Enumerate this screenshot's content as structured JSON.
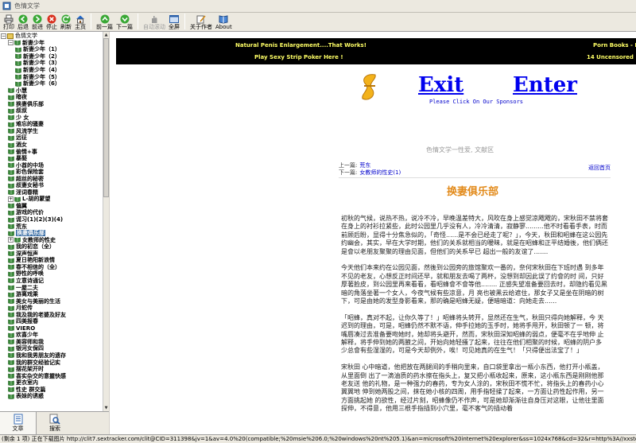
{
  "window": {
    "title": "色情文学"
  },
  "toolbar": {
    "buttons": [
      {
        "label": "打印",
        "icon": "print-icon"
      },
      {
        "label": "后退",
        "icon": "back-arrow-icon"
      },
      {
        "label": "前进",
        "icon": "forward-arrow-icon"
      },
      {
        "label": "停止",
        "icon": "stop-icon"
      },
      {
        "label": "刷新",
        "icon": "refresh-icon"
      },
      {
        "label": "主页",
        "icon": "home-icon"
      },
      {
        "label": "前一篇",
        "icon": "up-arrow-icon"
      },
      {
        "label": "下一篇",
        "icon": "down-arrow-icon"
      },
      {
        "label": "自动滚动",
        "icon": "hand-icon"
      },
      {
        "label": "全屏",
        "icon": "fullscreen-icon"
      },
      {
        "label": "关于作者",
        "icon": "author-icon"
      },
      {
        "label": "About",
        "icon": "book-icon"
      }
    ]
  },
  "sidebar": {
    "tree": [
      {
        "label": "色情文学",
        "level": 0,
        "expander": "−"
      },
      {
        "label": "新妻少年",
        "level": 1,
        "expander": "−"
      },
      {
        "label": "新妻少年（1）",
        "level": 2
      },
      {
        "label": "新妻少年（2）",
        "level": 2
      },
      {
        "label": "新妻少年（3）",
        "level": 2
      },
      {
        "label": "新妻少年（4）",
        "level": 2
      },
      {
        "label": "新妻少年（5）",
        "level": 2
      },
      {
        "label": "新妻少年（6）",
        "level": 2
      },
      {
        "label": "小慧",
        "level": 1
      },
      {
        "label": "暗夜",
        "level": 1
      },
      {
        "label": "换妻俱乐部",
        "level": 1
      },
      {
        "label": "叔叔",
        "level": 1
      },
      {
        "label": "少 女",
        "level": 1
      },
      {
        "label": "难忘的骚妻",
        "level": 1
      },
      {
        "label": "风流学生",
        "level": 1
      },
      {
        "label": "远征",
        "level": 1
      },
      {
        "label": "酒女",
        "level": 1
      },
      {
        "label": "偷情+事",
        "level": 1
      },
      {
        "label": "暴娶",
        "level": 1
      },
      {
        "label": "小酋的中场",
        "level": 1
      },
      {
        "label": "彩色保险套",
        "level": 1
      },
      {
        "label": "超丝的秘密",
        "level": 1
      },
      {
        "label": "叔妻女秘书",
        "level": 1
      },
      {
        "label": "淫词春精",
        "level": 1
      },
      {
        "label": "L-胡的蒙望",
        "level": 1,
        "expander": "+"
      },
      {
        "label": "偏翼",
        "level": 1
      },
      {
        "label": "游戏的代价",
        "level": 1
      },
      {
        "label": "谎习(1)(2)(3)(4)",
        "level": 1
      },
      {
        "label": "荒东",
        "level": 1
      },
      {
        "label": "换妻俱乐部",
        "level": 1,
        "selected": true
      },
      {
        "label": "女教师的性史",
        "level": 1,
        "expander": "+"
      },
      {
        "label": "我的初恋（全）",
        "level": 1
      },
      {
        "label": "深声恒声",
        "level": 1
      },
      {
        "label": "夏日艳阳新浪情",
        "level": 1
      },
      {
        "label": "春不相信的（全）",
        "level": 1
      },
      {
        "label": "野性的呼唤",
        "level": 1
      },
      {
        "label": "立意诗通记",
        "level": 1
      },
      {
        "label": "一屋二夫",
        "level": 1
      },
      {
        "label": "游离戏乘",
        "level": 1
      },
      {
        "label": "美女与美丽的生活",
        "level": 1
      },
      {
        "label": "月蛇传",
        "level": 1
      },
      {
        "label": "我及我的老婆及好友",
        "level": 1
      },
      {
        "label": "四美报春",
        "level": 1
      },
      {
        "label": "VIERO",
        "level": 1
      },
      {
        "label": "欢喜少年",
        "level": 1
      },
      {
        "label": "美容师和我",
        "level": 1
      },
      {
        "label": "银河女保四",
        "level": 1
      },
      {
        "label": "我和我男朋友的遗存",
        "level": 1
      },
      {
        "label": "我的群交经验记实",
        "level": 1
      },
      {
        "label": "摆花架开时",
        "level": 1
      },
      {
        "label": "喜实杂交的意握快感",
        "level": 1
      },
      {
        "label": "更衣室内",
        "level": 1
      },
      {
        "label": "性史 群交篇",
        "level": 1
      },
      {
        "label": "表妹的诱惑",
        "level": 1
      }
    ],
    "tabs": [
      {
        "label": "文章",
        "icon": "document-icon"
      },
      {
        "label": "搜索",
        "icon": "search-icon"
      }
    ]
  },
  "ads": {
    "left_line1": "Natural Penis Enlargement....That Works!",
    "left_line2": "Play Sexy Strip Poker Here !",
    "right_line1": "Porn Books - I",
    "right_line2": "14 Uncensored"
  },
  "exit_enter": {
    "exit": "Exit",
    "enter": "Enter",
    "sponsor": "Please Click On Our Sponsors"
  },
  "article": {
    "site_name": "色情文学一性爱, 文献区",
    "prev_label": "上一篇:",
    "prev_value": "荒东",
    "next_label": "下一篇:",
    "next_value": "女教师的性史(1)",
    "home_link": "返回首页",
    "title": "换妻俱乐部",
    "paragraphs": [
      "初秋的气候，说热不热，说冷不冷，早晚温差特大，风吹在身上感觉凉飕飕的，宋秋田不禁将套在身上的衬衫拉紧些，此时公园里几乎没有人，冷冷清清，寂静寥.........他不时看看手表，时而前顾后盼，显得十分焦急似的，「奇怪......是不会已经走了呢？」，今天，秋田和昭蜂在这公园先约幽会，其实，早在大学时期，他们的关系就相当的暧昧，就是在昭蜂和正平结婚後，他们俩还是會以老朋友聚聚的理由见面，但他们的关系早已 超出一般的友谊了.......",
      "今天他们本来约在公园见面，然後到公园旁的旅馆聚欢一番的，奈何宋秋田在下班时遇 到多年不见的老友，心想反正时间还早，就和朋友去喝了两杯，没想到却因此误了约會的时 间，只好厚著脸皮，到公园里再来看看，看昭蜂會不會等他........ 正感失望准备要回去时，却隐约看见黑暗的角落坐著一个女人，今夜气候有些凉意，月 亮也被黑云给遮住，那女子又是坐在阴暗的树下，可是由她的发型身影看来，那的确是昭蜂无疑，便暗暗道：向她走去......",
      "「昭蜂，真对不起，让你久等了！」昭蜂将头转开，显然还在生气，秋田只得向她解释，今 天迟到的理由，可是，昭蜂仍然不默不语，伸手拉她的玉手时，她将手甩开，秋田顿了一 顿，将 嘴唇凑过去准备要吻她时，她却将头避开，然而，宋秋田深知昭蜂的弱点，便毫不在乎地伸 止 解释，将手伸到她的两腋之间，开始向她轻搔了起来，往往在他们相聚的时候，昭蜂的阴户多 少总會有些湿湿的，可是今天却例外，唉！可见她真的在生气！「只得便出法宝了！」",
      "宋秋田 心中暗道，他把放在两腿间的手稍向里来，自口袋里拿出一瓶小东西，他打开小瓶盖，从里面倒 出了一滴油质的药水擦在指头上，复又把小瓶收起来，原来，这小瓶东西是刚刚他那老友送 他的礼物，是一种强力的春药，专为女人涂的，宋秋田不慌不忙，将指头上的春药小心翼翼地 伸到她两股之间，抹在她小核的四周，用手指轻揉了起来，一方面让药性起作用，另一方面挑起她 的欲性，经过片刻，昭蜂像仍不作声，可是她却渐渐往自身压对这眼，让他往里面探伸，不得意，他用三根手指插到小穴里，毫不客气的插动着"
    ]
  },
  "status": "(剩余 1 项) 正在下载图片 http://clit7.sextracker.com/clit@CID=311398&jv=1&av=4.0%20(compatible;%20msie%206.0;%20windows%20nt%205.1)&an=microsoft%20internet%20explorer&ss=1024x768&cd=32&r=http%3A//xxstory.sexushost.com/xxs"
}
